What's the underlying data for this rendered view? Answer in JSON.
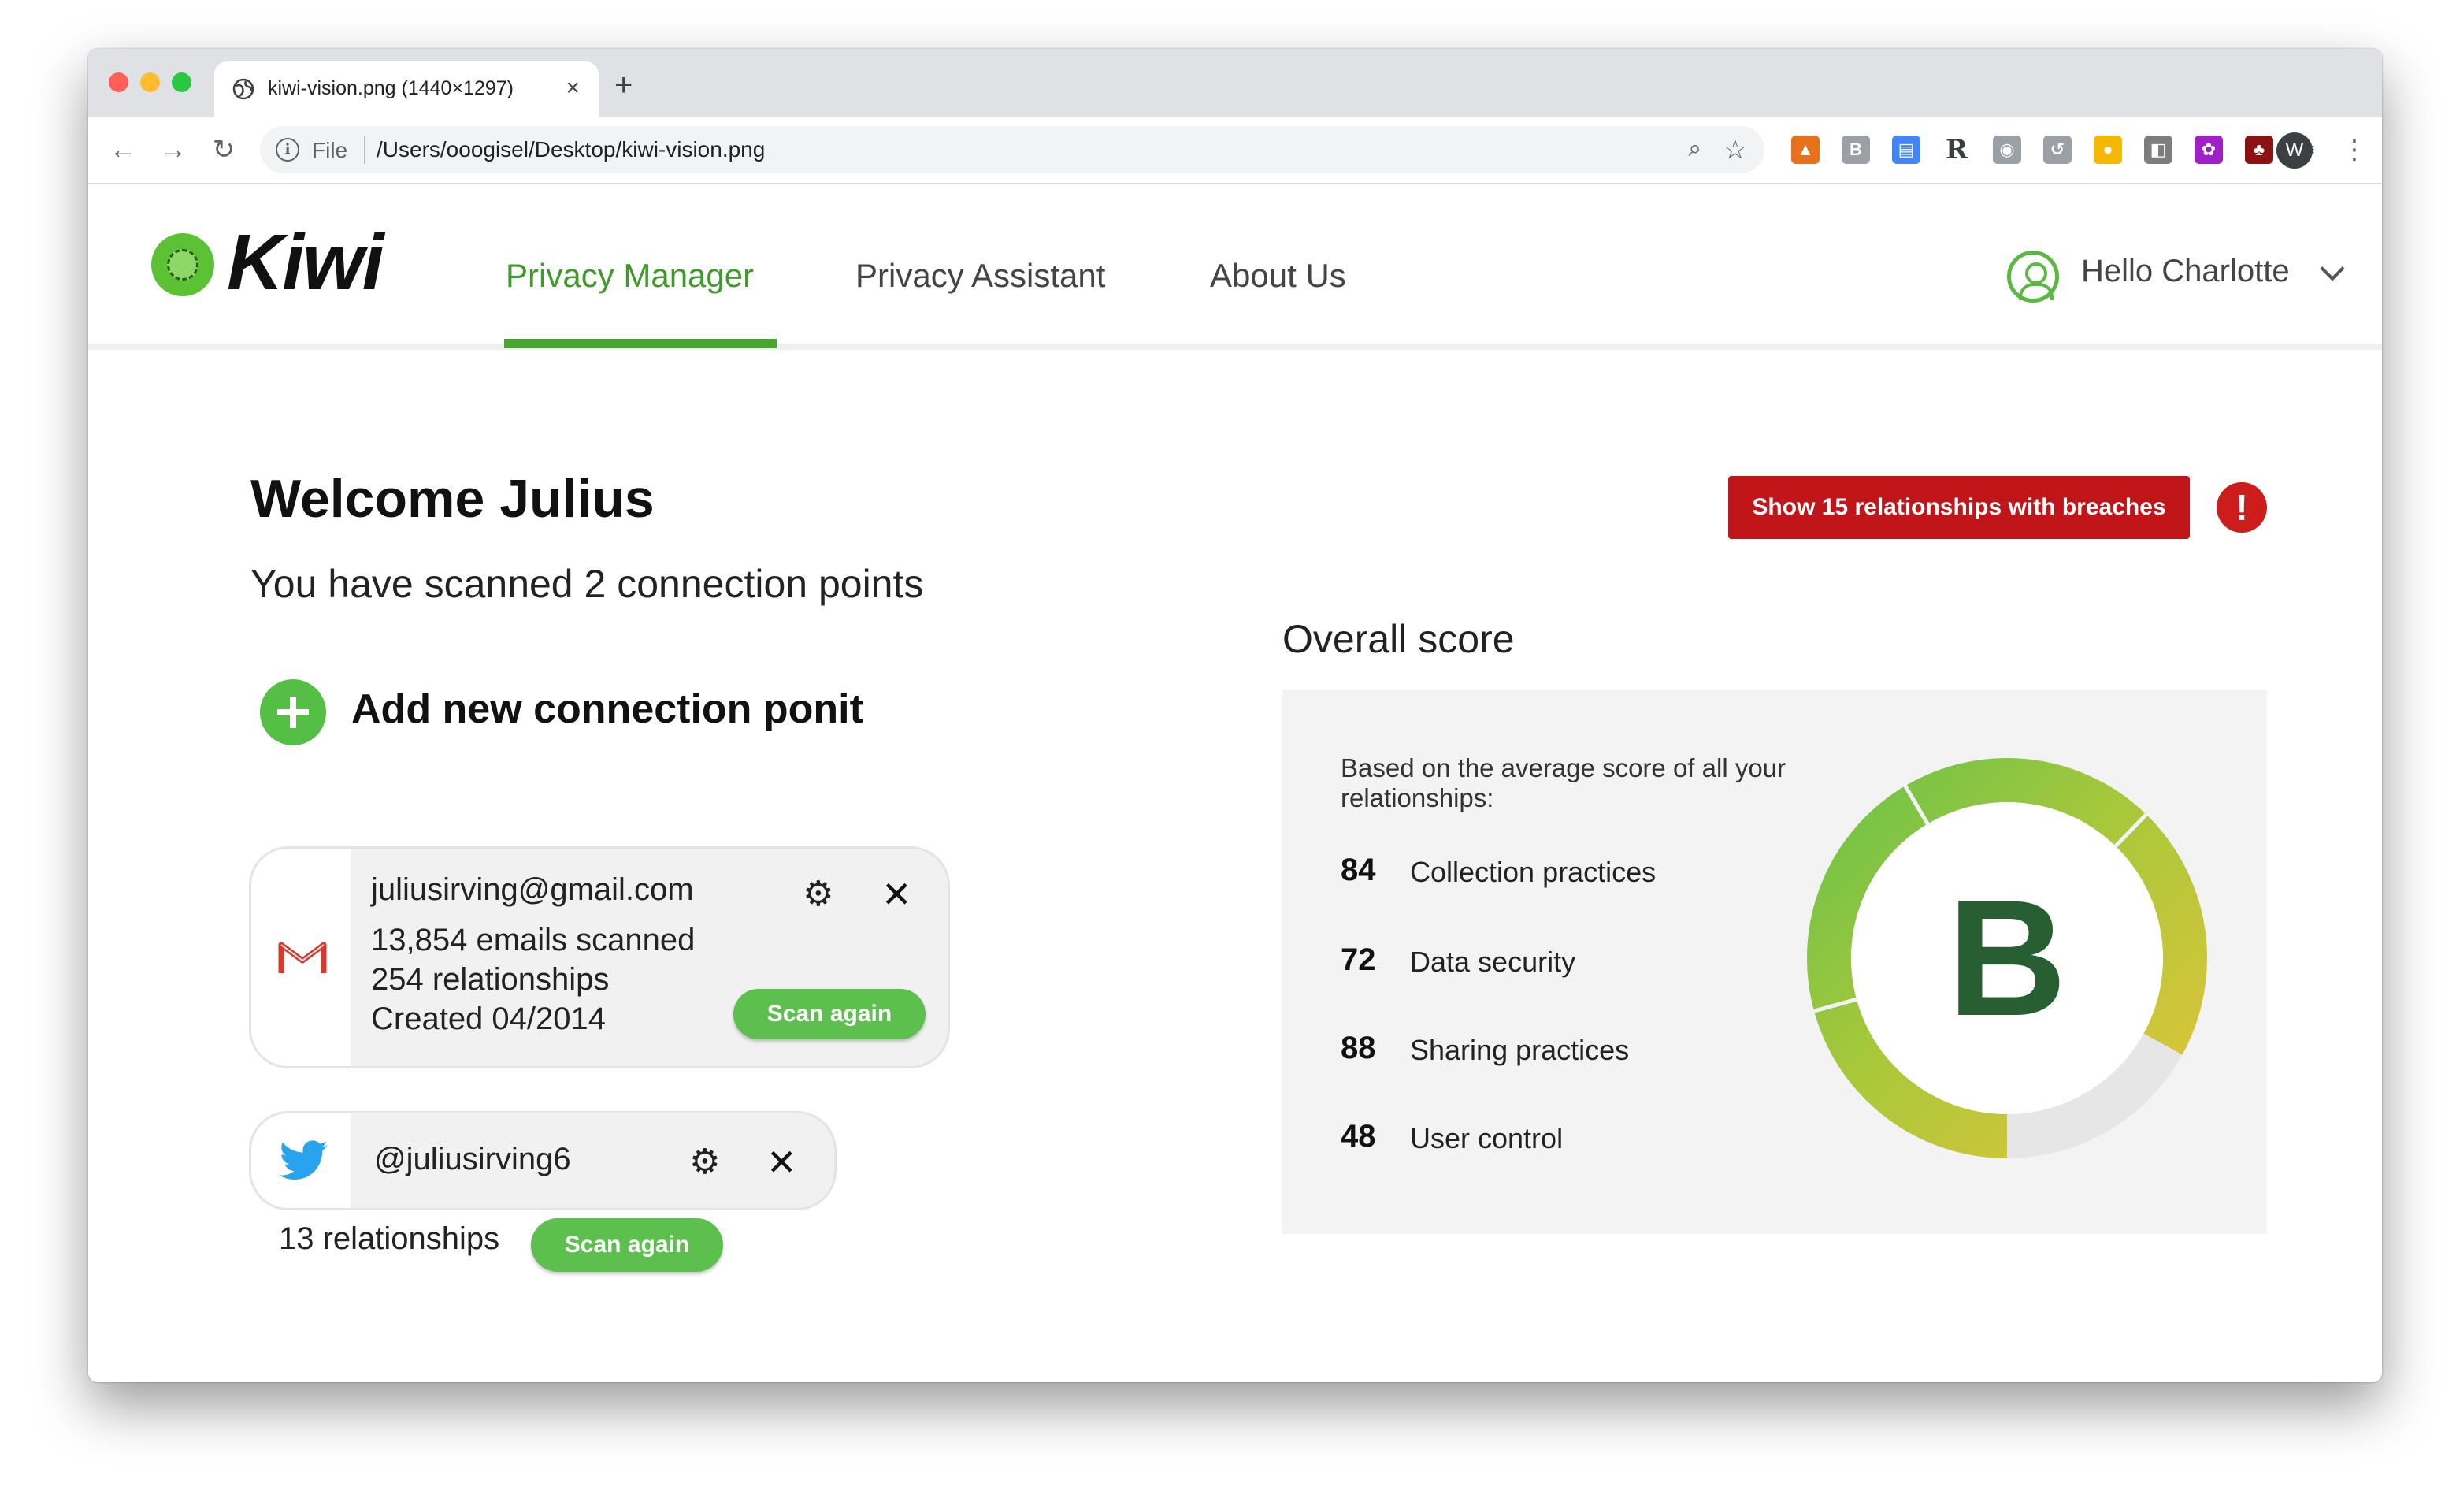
{
  "browser": {
    "tab_title": "kiwi-vision.png (1440×1297)",
    "tab_close": "×",
    "new_tab": "+",
    "back": "←",
    "forward": "→",
    "reload": "↻",
    "info": "i",
    "scheme": "File",
    "url": "/Users/ooogisel/Desktop/kiwi-vision.png",
    "zoom_icon": "⌕",
    "star_icon": "☆",
    "extensions": [
      {
        "name": "chart-extension-icon",
        "color": "#e8711c",
        "glyph": "▲"
      },
      {
        "name": "bold-extension-icon",
        "color": "#9aa0a6",
        "glyph": "B"
      },
      {
        "name": "reader-extension-icon",
        "color": "#4285f4",
        "glyph": "▤"
      },
      {
        "name": "r-extension-icon",
        "color": "#ffffff",
        "glyph": "R"
      },
      {
        "name": "camera-extension-icon",
        "color": "#9aa0a6",
        "glyph": "◉"
      },
      {
        "name": "history-extension-icon",
        "color": "#9aa0a6",
        "glyph": "↺"
      },
      {
        "name": "coin-extension-icon",
        "color": "#f5b800",
        "glyph": "●"
      },
      {
        "name": "square-extension-icon",
        "color": "#7d7d7d",
        "glyph": "◧"
      },
      {
        "name": "purple-extension-icon",
        "color": "#a020c8",
        "glyph": "✿"
      },
      {
        "name": "game-extension-icon",
        "color": "#8a1212",
        "glyph": "♣"
      },
      {
        "name": "playlist-extension-icon",
        "color": "#ffffff",
        "glyph": "≡"
      }
    ],
    "profile_initial": "W",
    "menu": "⋮"
  },
  "app": {
    "logo_text": "Kiwi",
    "nav": [
      {
        "label": "Privacy Manager",
        "active": true
      },
      {
        "label": "Privacy Assistant",
        "active": false
      },
      {
        "label": "About Us",
        "active": false
      }
    ],
    "user_greeting": "Hello Charlotte"
  },
  "main": {
    "welcome": "Welcome Julius",
    "subtitle": "You have scanned 2 connection points",
    "add_connection": "Add new connection ponit",
    "breach_button": "Show 15 relationships with breaches",
    "alert_glyph": "!"
  },
  "connections": {
    "gmail": {
      "email": "juliusirving@gmail.com",
      "emails_scanned": "13,854 emails scanned",
      "relationships": "254 relationships",
      "created": "Created 04/2014",
      "scan_label": "Scan again",
      "gear": "⚙",
      "close": "✕"
    },
    "twitter": {
      "handle": "@juliusirving6",
      "relationships": "13 relationships",
      "scan_label": "Scan again",
      "gear": "⚙",
      "close": "✕"
    }
  },
  "score": {
    "title": "Overall score",
    "description": "Based on the average score of all your relationships:",
    "grade": "B",
    "metrics": [
      {
        "value": "84",
        "label": "Collection practices"
      },
      {
        "value": "72",
        "label": "Data security"
      },
      {
        "value": "88",
        "label": "Sharing practices"
      },
      {
        "value": "48",
        "label": "User control"
      }
    ],
    "colors": {
      "green": "#6cc24a",
      "yellow_green": "#b7c93b",
      "yellow": "#e2c43a",
      "empty": "#e6e6e6"
    }
  },
  "colors": {
    "brand_green": "#4aa52f",
    "danger_red": "#c0161a"
  }
}
